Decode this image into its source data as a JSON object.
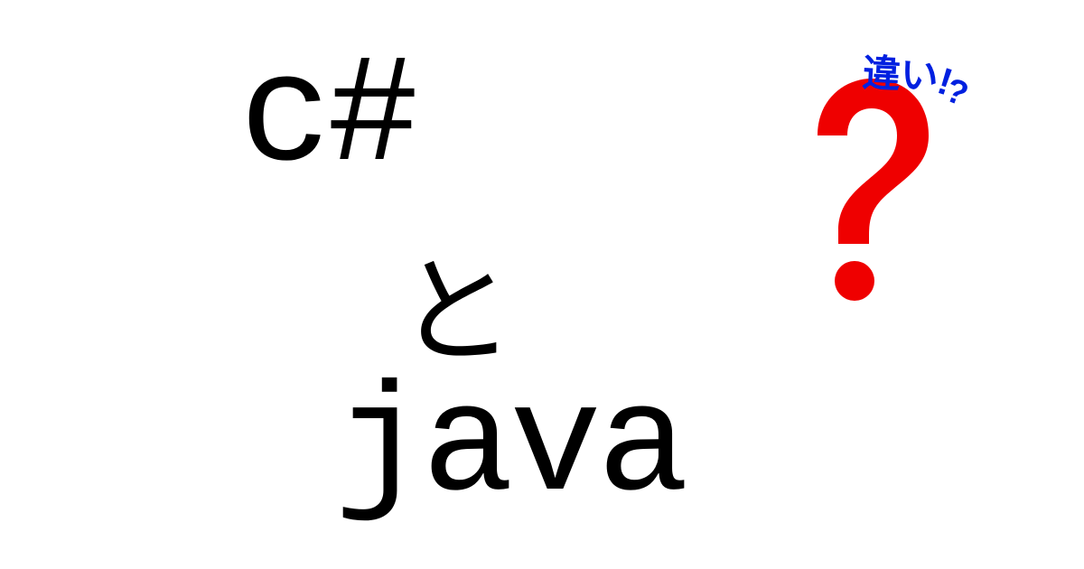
{
  "text": {
    "csharp": "c#",
    "connector": "と",
    "java": "java"
  },
  "annotation": {
    "main": "違い",
    "exc": "!",
    "qm": "?"
  },
  "colors": {
    "questionMark": "#ef0000",
    "annotation": "#0020e0",
    "text": "#000000"
  }
}
